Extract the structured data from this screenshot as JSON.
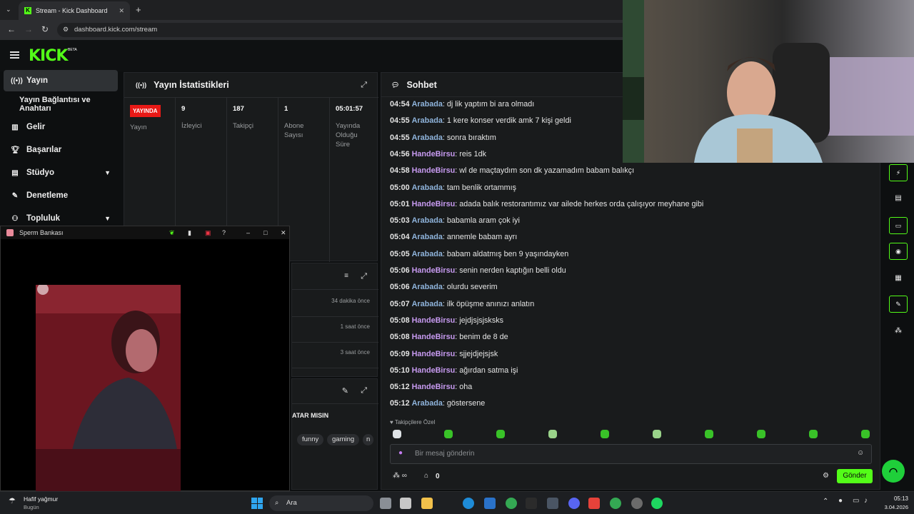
{
  "browser": {
    "tab_title": "Stream - Kick Dashboard",
    "tab_close": "✕",
    "new_tab": "+",
    "url": "dashboard.kick.com/stream"
  },
  "logo": {
    "text": "KICK",
    "beta": "BETA"
  },
  "sidebar": {
    "items": [
      {
        "label": "Yayın",
        "icon": "broadcast-icon"
      },
      {
        "label": "Yayın Bağlantısı ve Anahtarı"
      },
      {
        "label": "Gelir",
        "icon": "chart-icon"
      },
      {
        "label": "Başarılar",
        "icon": "trophy-icon"
      },
      {
        "label": "Stüdyo",
        "icon": "studio-icon"
      },
      {
        "label": "Denetleme",
        "icon": "wrench-icon"
      },
      {
        "label": "Topluluk",
        "icon": "community-icon"
      }
    ]
  },
  "stats": {
    "title": "Yayın İstatistikleri",
    "live_badge": "YAYINDA",
    "live_label": "Yayın",
    "viewers_value": "9",
    "viewers_label": "İzleyici",
    "followers_value": "187",
    "followers_label": "Takipçi",
    "subs_value": "1",
    "subs_label": "Abone Sayısı",
    "duration_value": "05:01:57",
    "duration_label": "Yayında Olduğu Süre"
  },
  "activity": {
    "times": [
      "34 dakika önce",
      "1 saat önce",
      "3 saat önce"
    ]
  },
  "info": {
    "title_fragment": "ATAR MISIN",
    "tags": [
      "funny",
      "gaming",
      "n"
    ]
  },
  "chat": {
    "title": "Sohbet",
    "messages": [
      {
        "time": "04:54",
        "user": "Arabada",
        "text": "dj lik yaptım bi ara olmadı"
      },
      {
        "time": "04:55",
        "user": "Arabada",
        "text": "1 kere konser verdik amk 7 kişi geldi"
      },
      {
        "time": "04:55",
        "user": "Arabada",
        "text": "sonra bıraktım"
      },
      {
        "time": "04:56",
        "user": "HandeBirsu",
        "text": "reis 1dk"
      },
      {
        "time": "04:58",
        "user": "HandeBirsu",
        "text": "wl de maçtaydım son dk yazamadım babam balıkçı"
      },
      {
        "time": "05:00",
        "user": "Arabada",
        "text": "tam benlik ortammış"
      },
      {
        "time": "05:01",
        "user": "HandeBirsu",
        "text": "adada balık restorantımız var ailede herkes orda çalışıyor meyhane gibi"
      },
      {
        "time": "05:03",
        "user": "Arabada",
        "text": "babamla aram çok iyi"
      },
      {
        "time": "05:04",
        "user": "Arabada",
        "text": "annemle babam ayrı"
      },
      {
        "time": "05:05",
        "user": "Arabada",
        "text": "babam aldatmış ben 9 yaşındayken"
      },
      {
        "time": "05:06",
        "user": "HandeBirsu",
        "text": "senin nerden kaptığın belli oldu"
      },
      {
        "time": "05:06",
        "user": "Arabada",
        "text": "olurdu severim"
      },
      {
        "time": "05:07",
        "user": "Arabada",
        "text": "ilk öpüşme anınızı anlatın"
      },
      {
        "time": "05:08",
        "user": "HandeBirsu",
        "text": "jejdjsjsjsksks"
      },
      {
        "time": "05:08",
        "user": "HandeBirsu",
        "text": "benim de 8 de"
      },
      {
        "time": "05:09",
        "user": "HandeBirsu",
        "text": "sjjejdjejsjsk"
      },
      {
        "time": "05:10",
        "user": "HandeBirsu",
        "text": "ağırdan satma işi"
      },
      {
        "time": "05:12",
        "user": "HandeBirsu",
        "text": "oha"
      },
      {
        "time": "05:12",
        "user": "Arabada",
        "text": "göstersene"
      }
    ],
    "user_colors": {
      "Arabada": "#8fb4dc",
      "HandeBirsu": "#c79af0"
    },
    "followers_only": "Takipçilere Özel",
    "placeholder": "Bir mesaj gönderin",
    "points_value": "0",
    "send_label": "Gönder"
  },
  "spotify": {
    "title": "Sperm Bankası"
  },
  "taskbar": {
    "weather": "Hafif yağmur",
    "weather_sub": "Bugün",
    "search": "Ara",
    "time": "05:13",
    "date": "3.04.2026"
  },
  "colors": {
    "accent": "#53fc18",
    "live": "#e91916"
  }
}
